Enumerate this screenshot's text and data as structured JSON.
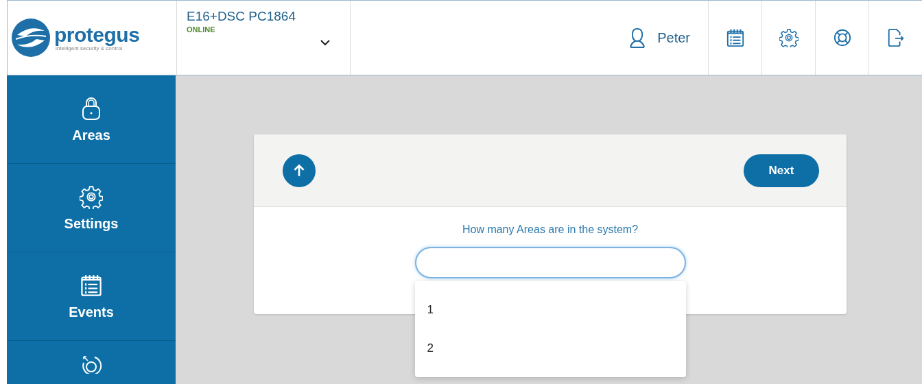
{
  "logo": {
    "name": "protegus",
    "tagline": "intelligent security & control"
  },
  "device": {
    "name": "E16+DSC PC1864",
    "status": "ONLINE"
  },
  "user": {
    "name": "Peter"
  },
  "toolbar": [
    {
      "kind": "events"
    },
    {
      "kind": "settings"
    },
    {
      "kind": "help"
    },
    {
      "kind": "logout"
    }
  ],
  "sidebar": {
    "items": [
      {
        "kind": "lock",
        "label": "Areas"
      },
      {
        "kind": "settings",
        "label": "Settings"
      },
      {
        "kind": "events",
        "label": "Events"
      },
      {
        "kind": "reset"
      }
    ]
  },
  "wizard": {
    "next": "Next",
    "question": "How many Areas are in the system?",
    "options": [
      "1",
      "2"
    ]
  }
}
